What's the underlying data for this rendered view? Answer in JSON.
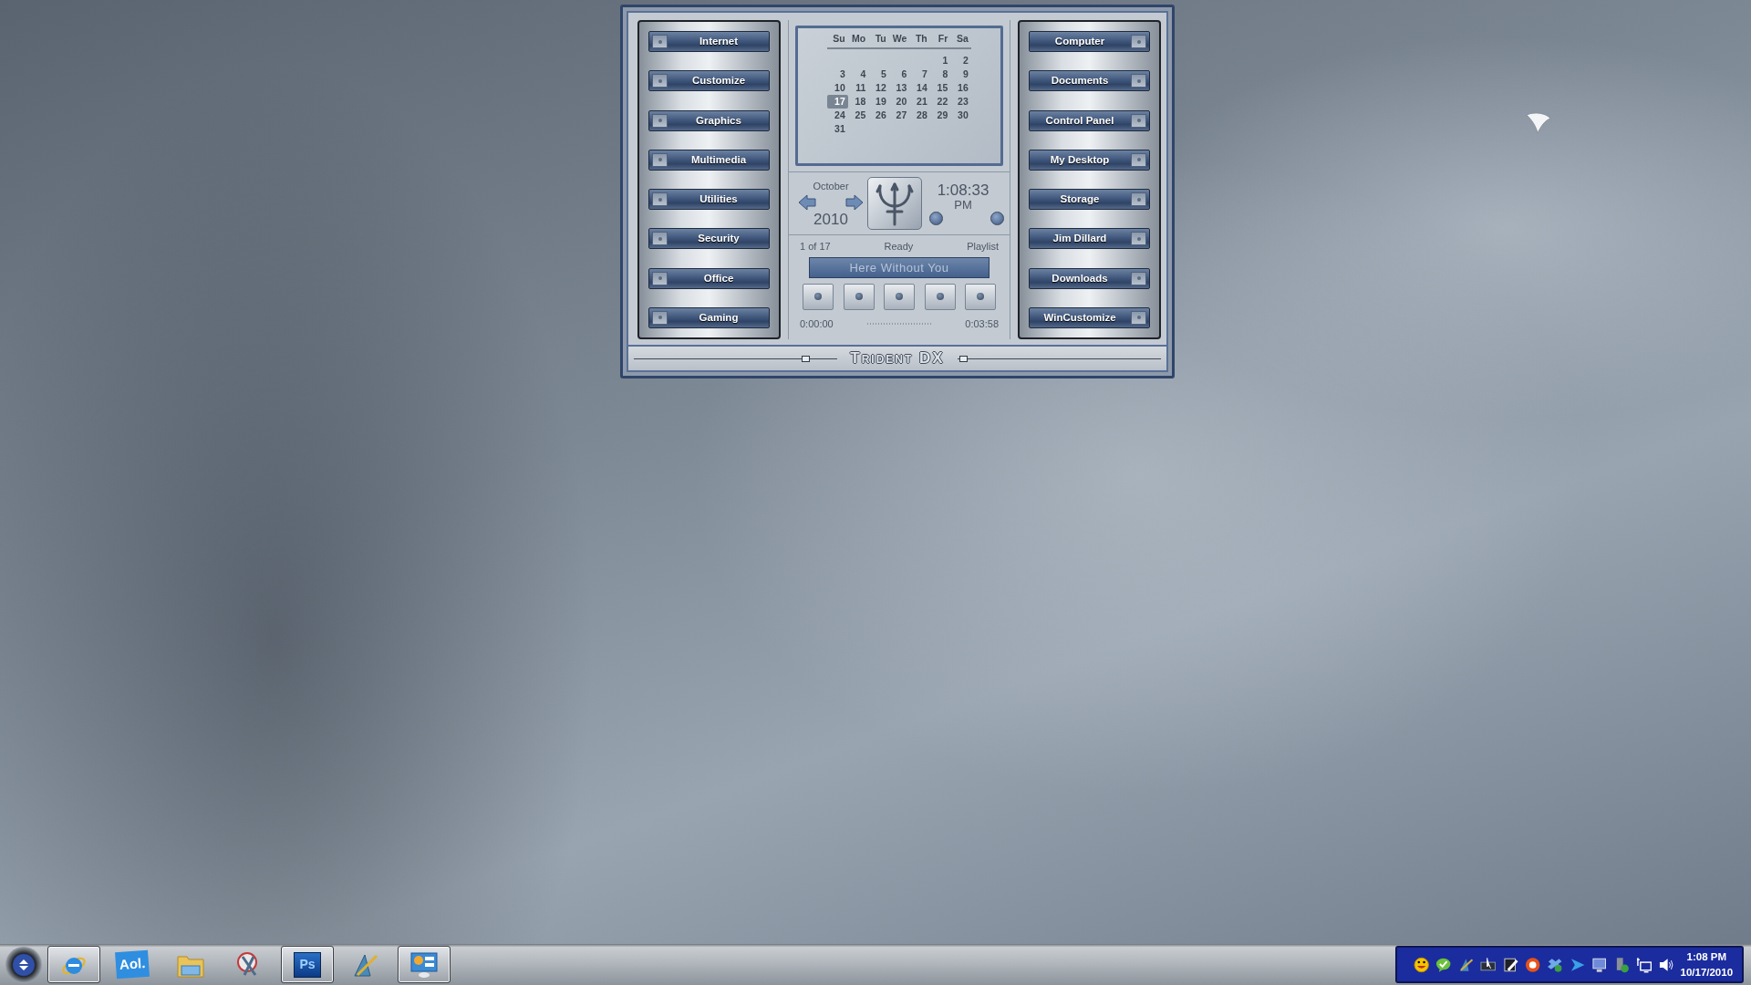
{
  "widget": {
    "title": "Trident DX",
    "left_buttons": [
      {
        "label": "Internet"
      },
      {
        "label": "Customize"
      },
      {
        "label": "Graphics"
      },
      {
        "label": "Multimedia"
      },
      {
        "label": "Utilities"
      },
      {
        "label": "Security"
      },
      {
        "label": "Office"
      },
      {
        "label": "Gaming"
      }
    ],
    "calendar": {
      "weekdays": [
        "Su",
        "Mo",
        "Tu",
        "We",
        "Th",
        "Fr",
        "Sa"
      ],
      "weeks": [
        {
          "kind": "leading",
          "days": [
            {
              "day": "1",
              "selected": false
            },
            {
              "day": "2",
              "selected": false
            }
          ]
        },
        {
          "kind": "regular",
          "days": [
            {
              "day": "3",
              "selected": false
            },
            {
              "day": "4",
              "selected": false
            },
            {
              "day": "5",
              "selected": false
            },
            {
              "day": "6",
              "selected": false
            },
            {
              "day": "7",
              "selected": false
            },
            {
              "day": "8",
              "selected": false
            },
            {
              "day": "9",
              "selected": false
            }
          ]
        },
        {
          "kind": "regular",
          "days": [
            {
              "day": "10",
              "selected": false
            },
            {
              "day": "11",
              "selected": false
            },
            {
              "day": "12",
              "selected": false
            },
            {
              "day": "13",
              "selected": false
            },
            {
              "day": "14",
              "selected": false
            },
            {
              "day": "15",
              "selected": false
            },
            {
              "day": "16",
              "selected": false
            }
          ]
        },
        {
          "kind": "regular",
          "days": [
            {
              "day": "17",
              "selected": true
            },
            {
              "day": "18",
              "selected": false
            },
            {
              "day": "19",
              "selected": false
            },
            {
              "day": "20",
              "selected": false
            },
            {
              "day": "21",
              "selected": false
            },
            {
              "day": "22",
              "selected": false
            },
            {
              "day": "23",
              "selected": false
            }
          ]
        },
        {
          "kind": "regular",
          "days": [
            {
              "day": "24",
              "selected": false
            },
            {
              "day": "25",
              "selected": false
            },
            {
              "day": "26",
              "selected": false
            },
            {
              "day": "27",
              "selected": false
            },
            {
              "day": "28",
              "selected": false
            },
            {
              "day": "29",
              "selected": false
            },
            {
              "day": "30",
              "selected": false
            }
          ]
        },
        {
          "kind": "regular",
          "days": [
            {
              "day": "31",
              "selected": false
            }
          ]
        }
      ]
    },
    "month": "October",
    "year": "2010",
    "clock": {
      "time": "1:08:33",
      "period": "PM"
    },
    "player": {
      "track_count": "1 of 17",
      "status": "Ready",
      "playlist": "Playlist",
      "track_title": "Here Without You",
      "elapsed": "0:00:00",
      "duration": "0:03:58"
    },
    "right_buttons": [
      {
        "label": "Computer"
      },
      {
        "label": "Documents"
      },
      {
        "label": "Control Panel"
      },
      {
        "label": "My Desktop"
      },
      {
        "label": "Storage"
      },
      {
        "label": "Jim Dillard"
      },
      {
        "label": "Downloads"
      },
      {
        "label": "WinCustomize"
      }
    ],
    "sliders": [
      {
        "level": 0.84
      },
      {
        "level": 0.03
      }
    ]
  },
  "taskbar": {
    "apps": [
      {
        "kind": "browser",
        "running": true
      },
      {
        "kind": "aol",
        "label": "Aol.",
        "running": false
      },
      {
        "kind": "folder",
        "running": false
      },
      {
        "kind": "scissors",
        "running": false
      },
      {
        "kind": "ps",
        "label": "Ps",
        "running": true
      },
      {
        "kind": "pen",
        "running": false
      },
      {
        "kind": "panel",
        "running": true
      }
    ],
    "tray": {
      "icons": [
        {
          "kind": "smiley"
        },
        {
          "kind": "chat"
        },
        {
          "kind": "pen"
        },
        {
          "kind": "screen-pointer"
        },
        {
          "kind": "tablet"
        },
        {
          "kind": "ring"
        },
        {
          "kind": "box"
        },
        {
          "kind": "arrow"
        },
        {
          "kind": "monitor"
        },
        {
          "kind": "drive"
        },
        {
          "kind": "network"
        },
        {
          "kind": "speaker"
        }
      ],
      "time": "1:08 PM",
      "date": "10/17/2010"
    }
  }
}
